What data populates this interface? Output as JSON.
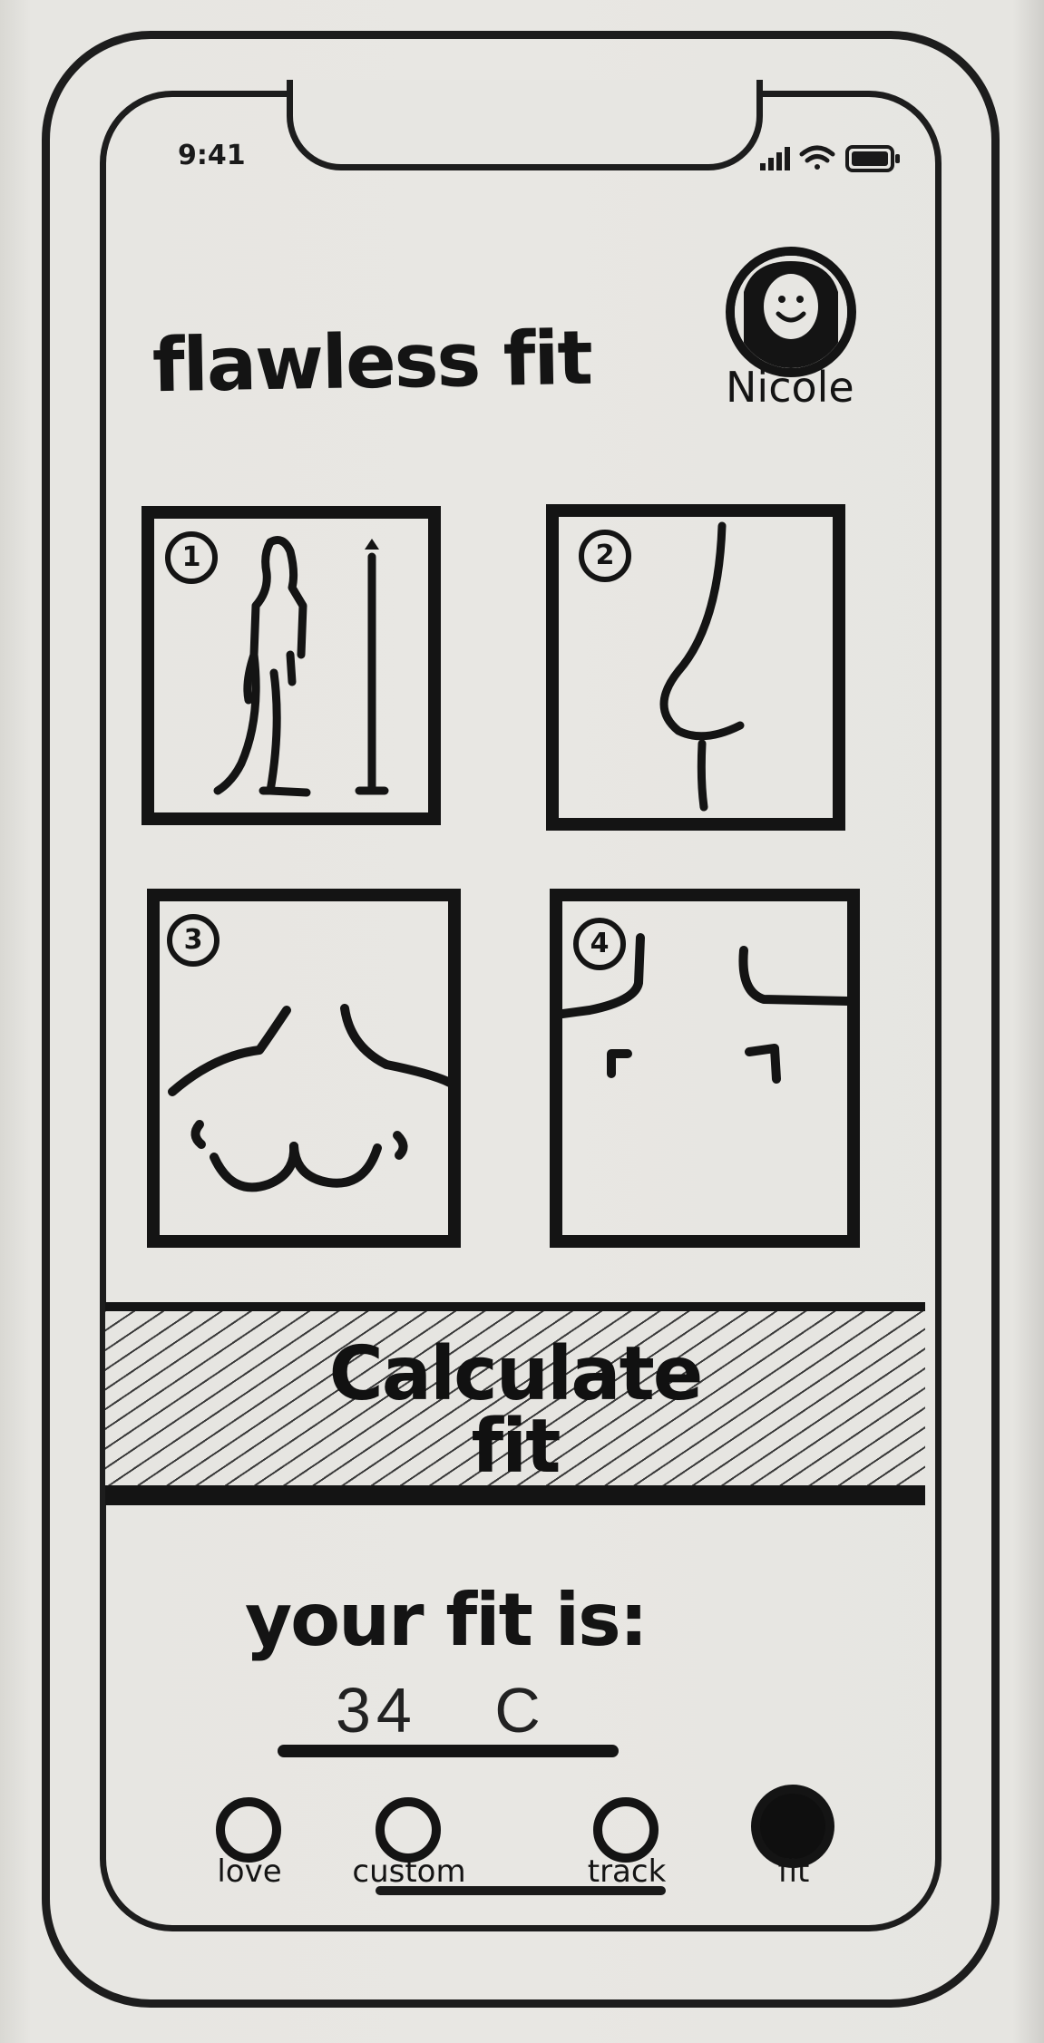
{
  "status_bar": {
    "time": "9:41"
  },
  "header": {
    "title": "flawless fit",
    "user_name": "Nicole"
  },
  "steps": [
    {
      "number": "1"
    },
    {
      "number": "2"
    },
    {
      "number": "3"
    },
    {
      "number": "4"
    }
  ],
  "calculate_button": {
    "line1": "Calculate",
    "line2": "fit"
  },
  "result": {
    "title": "your fit is:",
    "value": "34 C"
  },
  "tab_bar": {
    "items": [
      {
        "label": "love",
        "icon": "circle-outline-icon",
        "active": false
      },
      {
        "label": "custom",
        "icon": "circle-outline-icon",
        "active": false
      },
      {
        "label": "track",
        "icon": "circle-outline-icon",
        "active": false
      },
      {
        "label": "fit",
        "icon": "circle-filled-icon",
        "active": true
      }
    ]
  },
  "colors": {
    "ink": "#141414",
    "paper": "#e7e6e2"
  }
}
